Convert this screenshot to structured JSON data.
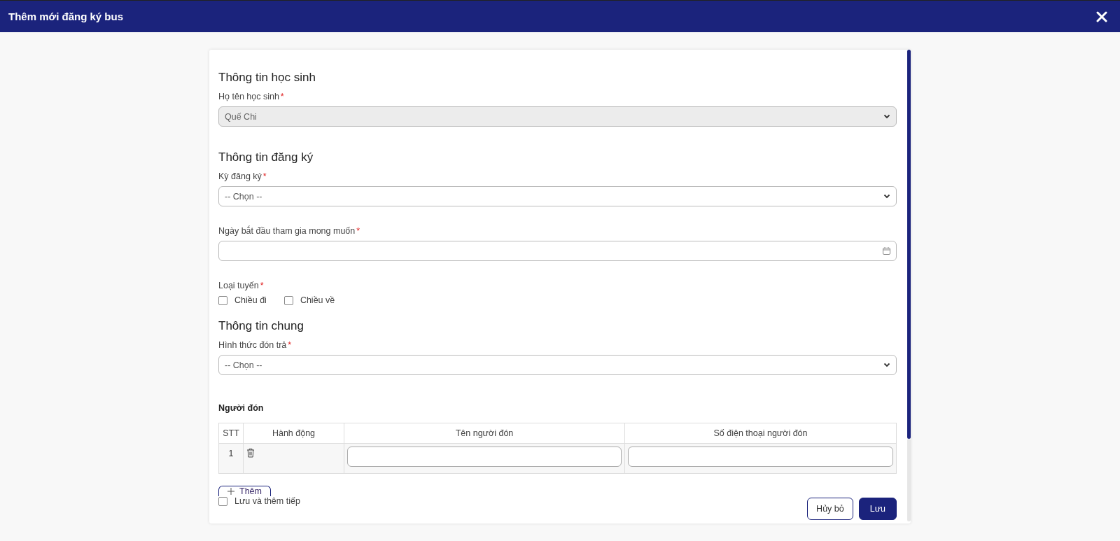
{
  "window": {
    "title": "Thêm mới đăng ký bus"
  },
  "blocks": [
    {
      "kind": "heading",
      "text": "Thông tin học sinh"
    },
    {
      "kind": "select",
      "label": "Họ tên học sinh",
      "required_mark": "*",
      "value": "Quế Chi",
      "disabled": true
    },
    {
      "kind": "heading",
      "text": "Thông tin đăng ký"
    },
    {
      "kind": "select",
      "label": "Kỳ đăng ký",
      "required_mark": "*",
      "placeholder": "-- Chọn --",
      "disabled": false
    },
    {
      "kind": "date",
      "label": "Ngày bắt đầu tham gia mong muốn",
      "required_mark": "*"
    },
    {
      "kind": "checkboxes",
      "label": "Loại tuyến",
      "required_mark": "*",
      "options": [
        {
          "label": "Chiều đi",
          "checked": false
        },
        {
          "label": "Chiều về",
          "checked": false
        }
      ]
    },
    {
      "kind": "heading",
      "text": "Thông tin chung"
    },
    {
      "kind": "select",
      "label": "Hình thức đón trả",
      "required_mark": "*",
      "placeholder": "-- Chọn --",
      "disabled": false
    },
    {
      "kind": "subheading",
      "text": "Người đón"
    },
    {
      "kind": "table",
      "columns": [
        "STT",
        "Hành động",
        "Tên người đón",
        "Số điện thoại người đón"
      ],
      "rows": [
        {
          "stt": "1"
        }
      ]
    },
    {
      "kind": "add_button",
      "text": "Thêm"
    }
  ],
  "footer": {
    "save_and_continue": {
      "label": "Lưu và thêm tiếp",
      "checked": false
    },
    "buttons": [
      {
        "label": "Hủy bỏ",
        "kind": "secondary"
      },
      {
        "label": "Lưu",
        "kind": "primary"
      }
    ]
  }
}
